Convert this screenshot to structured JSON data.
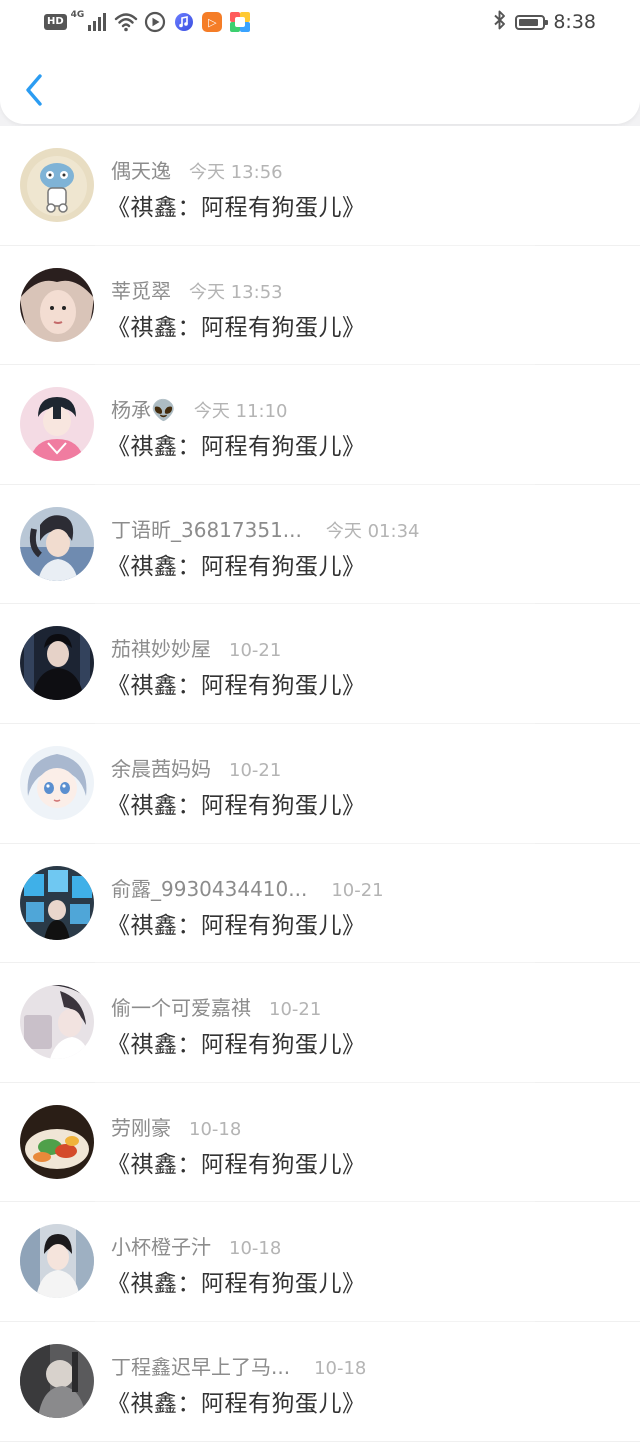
{
  "status_bar": {
    "hd_label": "HD",
    "network_label": "4G",
    "time": "8:38",
    "battery_percent": 75,
    "icons": [
      "signal-icon",
      "wifi-icon",
      "video-app-icon",
      "music-app-icon",
      "media-app-icon",
      "chat-app-icon",
      "bluetooth-icon",
      "battery-icon"
    ]
  },
  "header": {
    "back_icon": "chevron-left-icon"
  },
  "messages": [
    {
      "username": "偶天逸",
      "time": "今天 13:56",
      "title": "《祺鑫：阿程有狗蛋儿》"
    },
    {
      "username": "莘觅翠",
      "time": "今天 13:53",
      "title": "《祺鑫：阿程有狗蛋儿》"
    },
    {
      "username": "杨承👽",
      "time": "今天 11:10",
      "title": "《祺鑫：阿程有狗蛋儿》"
    },
    {
      "username": "丁语昕_36817351...",
      "time": "今天 01:34",
      "title": "《祺鑫：阿程有狗蛋儿》"
    },
    {
      "username": "茄祺妙妙屋",
      "time": "10-21",
      "title": "《祺鑫：阿程有狗蛋儿》"
    },
    {
      "username": "余晨茜妈妈",
      "time": "10-21",
      "title": "《祺鑫：阿程有狗蛋儿》"
    },
    {
      "username": "俞露_9930434410...",
      "time": "10-21",
      "title": "《祺鑫：阿程有狗蛋儿》"
    },
    {
      "username": "偷一个可爱嘉祺",
      "time": "10-21",
      "title": "《祺鑫：阿程有狗蛋儿》"
    },
    {
      "username": "劳刚豪",
      "time": "10-18",
      "title": "《祺鑫：阿程有狗蛋儿》"
    },
    {
      "username": "小杯橙子汁",
      "time": "10-18",
      "title": "《祺鑫：阿程有狗蛋儿》"
    },
    {
      "username": "丁程鑫迟早上了马...",
      "time": "10-18",
      "title": "《祺鑫：阿程有狗蛋儿》"
    }
  ],
  "colors": {
    "accent": "#2b9cf2",
    "username": "#8c8c8c",
    "timestamp": "#b4b4b4",
    "title": "#333333",
    "background": "#f2f2f4"
  }
}
